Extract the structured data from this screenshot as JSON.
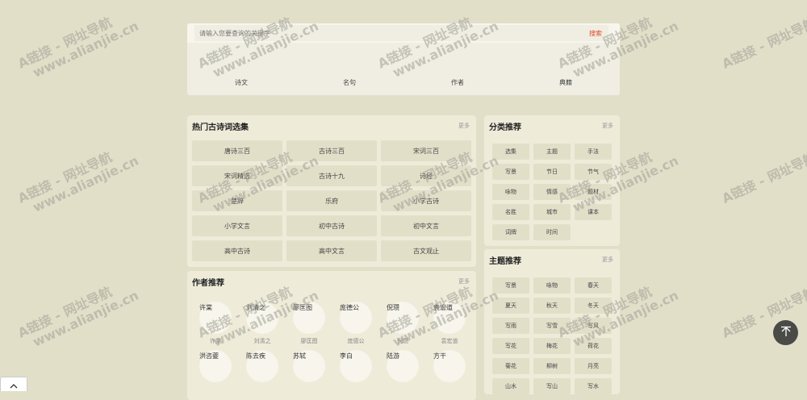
{
  "search": {
    "placeholder": "请输入您要查询的关键字",
    "button": "搜索",
    "tabs": [
      "诗文",
      "名句",
      "作者",
      "典籍"
    ]
  },
  "hot": {
    "title": "热门古诗词选集",
    "more": "更多",
    "items": [
      "唐诗三百",
      "古诗三百",
      "宋词三百",
      "宋词精选",
      "古诗十九",
      "诗经",
      "楚辞",
      "乐府",
      "小学古诗",
      "小学文言",
      "初中古诗",
      "初中文言",
      "高中古诗",
      "高中文言",
      "古文观止"
    ]
  },
  "authors": {
    "title": "作者推荐",
    "more": "更多",
    "items": [
      {
        "alt": "许棠",
        "name": "许棠"
      },
      {
        "alt": "刘清之",
        "name": "刘清之"
      },
      {
        "alt": "廖匡图",
        "name": "廖匡图"
      },
      {
        "alt": "庞德公",
        "name": "庞德公"
      },
      {
        "alt": "倪瓒",
        "name": "倪瓒"
      },
      {
        "alt": "袁宏道",
        "name": "袁宏道"
      },
      {
        "alt": "洪咨夔",
        "name": ""
      },
      {
        "alt": "陈去疾",
        "name": ""
      },
      {
        "alt": "苏轼",
        "name": ""
      },
      {
        "alt": "李白",
        "name": ""
      },
      {
        "alt": "陆游",
        "name": ""
      },
      {
        "alt": "方干",
        "name": ""
      }
    ]
  },
  "category": {
    "title": "分类推荐",
    "more": "更多",
    "items": [
      "选集",
      "主题",
      "手法",
      "写景",
      "节日",
      "节气",
      "咏物",
      "情感",
      "题材",
      "名胜",
      "城市",
      "课本",
      "词牌",
      "时间"
    ]
  },
  "theme": {
    "title": "主题推荐",
    "more": "更多",
    "items": [
      "写景",
      "咏物",
      "春天",
      "夏天",
      "秋天",
      "冬天",
      "写雨",
      "写雪",
      "写风",
      "写花",
      "梅花",
      "荷花",
      "菊花",
      "柳树",
      "月亮",
      "山水",
      "写山",
      "写水"
    ]
  },
  "watermark": {
    "line1": "A链接 - 网址导航",
    "line2": "www.alianjie.cn"
  },
  "colors": {
    "background": "#e2dfc9",
    "panel": "#eeebd9",
    "search_button": "#e04a2b",
    "to_top": "#4a4a47"
  },
  "icons": {
    "to_top": "arrow-up-icon",
    "collapse": "chevron-up-icon"
  }
}
